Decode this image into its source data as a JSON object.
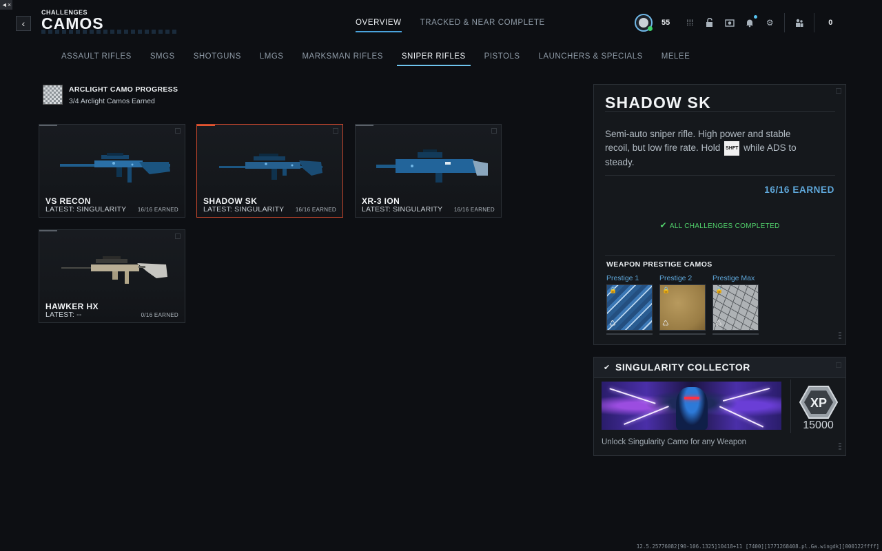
{
  "header": {
    "breadcrumb": "CHALLENGES",
    "title": "CAMOS",
    "tabs": [
      {
        "label": "OVERVIEW",
        "active": true
      },
      {
        "label": "TRACKED & NEAR COMPLETE",
        "active": false
      }
    ],
    "level": "55",
    "party_count": "0"
  },
  "categories": [
    {
      "label": "ASSAULT RIFLES",
      "active": false
    },
    {
      "label": "SMGS",
      "active": false
    },
    {
      "label": "SHOTGUNS",
      "active": false
    },
    {
      "label": "LMGS",
      "active": false
    },
    {
      "label": "MARKSMAN RIFLES",
      "active": false
    },
    {
      "label": "SNIPER RIFLES",
      "active": true
    },
    {
      "label": "PISTOLS",
      "active": false
    },
    {
      "label": "LAUNCHERS & SPECIALS",
      "active": false
    },
    {
      "label": "MELEE",
      "active": false
    }
  ],
  "arclight": {
    "title": "ARCLIGHT CAMO PROGRESS",
    "subtitle": "3/4 Arclight Camos Earned"
  },
  "weapons": [
    {
      "name": "VS RECON",
      "latest": "LATEST: SINGULARITY",
      "earned": "16/16 EARNED",
      "selected": false,
      "camo": "blue"
    },
    {
      "name": "SHADOW SK",
      "latest": "LATEST: SINGULARITY",
      "earned": "16/16 EARNED",
      "selected": true,
      "camo": "blue"
    },
    {
      "name": "XR-3 ION",
      "latest": "LATEST: SINGULARITY",
      "earned": "16/16 EARNED",
      "selected": false,
      "camo": "blue"
    },
    {
      "name": "HAWKER HX",
      "latest": "LATEST: --",
      "earned": "0/16 EARNED",
      "selected": false,
      "camo": "tan"
    }
  ],
  "details": {
    "title": "SHADOW SK",
    "desc_before": "Semi-auto sniper rifle. High power and stable recoil, but low fire rate. Hold",
    "desc_key": "SHFT",
    "desc_after": "while ADS to steady.",
    "earned": "16/16 EARNED",
    "completed": "ALL CHALLENGES COMPLETED",
    "prestige_heading": "WEAPON PRESTIGE CAMOS",
    "prestige": [
      {
        "label": "Prestige 1",
        "swatch": "sw-1"
      },
      {
        "label": "Prestige 2",
        "swatch": "sw-2"
      },
      {
        "label": "Prestige Max",
        "swatch": "sw-3"
      }
    ]
  },
  "reward": {
    "title": "SINGULARITY COLLECTOR",
    "xp_label": "XP",
    "xp_value": "15000",
    "description": "Unlock Singularity Camo for any Weapon"
  },
  "build_info": "12.5.25776082[90-106.1325]10418+11 [7400][1771268408.pl.Ga.wingdk][000122ffff]",
  "colors": {
    "accent_blue": "#5fa8db",
    "selected_border": "#c7472d",
    "completed_green": "#52d26c",
    "tab_underline": "#6fc4ee"
  }
}
